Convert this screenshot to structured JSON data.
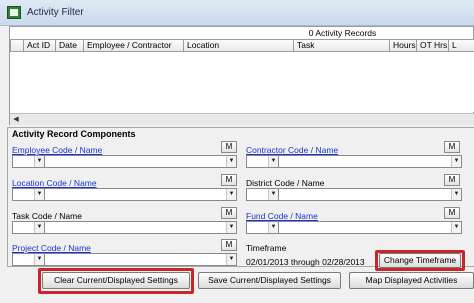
{
  "window": {
    "title": "Activity Filter"
  },
  "grid": {
    "record_count": "0 Activity Records",
    "columns": [
      "Act ID",
      "Date",
      "Employee / Contractor",
      "Location",
      "Task",
      "Hours",
      "OT Hrs",
      "L"
    ],
    "scroll_left": "◀"
  },
  "components": {
    "title": "Activity Record Components",
    "m_label": "M",
    "employee_label": "Employee Code / Name",
    "contractor_label": "Contractor Code / Name",
    "location_label": "Location Code / Name",
    "district_label": "District Code / Name",
    "task_label": "Task Code / Name",
    "fund_label": "Fund Code / Name",
    "project_label": "Project Code / Name",
    "timeframe_label": "Timeframe",
    "timeframe_value": "02/01/2013 through 02/28/2013",
    "dropdown_arrow": "▼"
  },
  "buttons": {
    "change_timeframe": "Change Timeframe",
    "clear_settings": "Clear Current/Displayed Settings",
    "save_settings": "Save Current/Displayed Settings",
    "map_activities": "Map Displayed Activities"
  },
  "colors": {
    "highlight": "#c9262c",
    "link": "#1a33cc"
  }
}
